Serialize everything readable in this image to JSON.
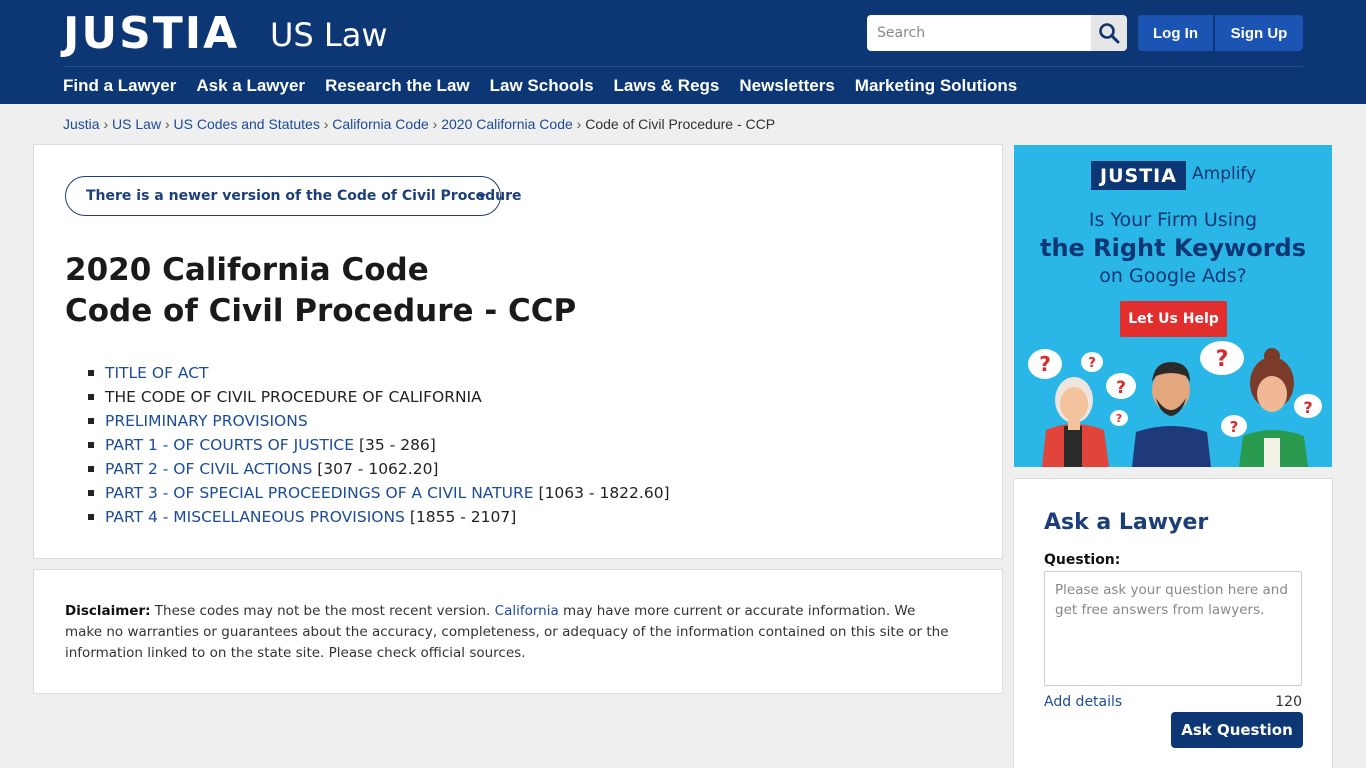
{
  "header": {
    "logo": "JUSTIA",
    "logo_sub": "US Law",
    "search_placeholder": "Search",
    "login_label": "Log In",
    "signup_label": "Sign Up",
    "nav": [
      "Find a Lawyer",
      "Ask a Lawyer",
      "Research the Law",
      "Law Schools",
      "Laws & Regs",
      "Newsletters",
      "Marketing Solutions"
    ]
  },
  "breadcrumb": {
    "items": [
      "Justia",
      "US Law",
      "US Codes and Statutes",
      "California Code",
      "2020 California Code"
    ],
    "current": "Code of Civil Procedure - CCP",
    "separator": "›"
  },
  "main": {
    "version_notice": "There is a newer version of the Code of Civil Procedure",
    "title_line1": "2020 California Code",
    "title_line2": "Code of Civil Procedure - CCP",
    "toc": [
      {
        "label": "TITLE OF ACT",
        "range": "",
        "link": true
      },
      {
        "label": "THE CODE OF CIVIL PROCEDURE OF CALIFORNIA",
        "range": "",
        "link": false
      },
      {
        "label": "PRELIMINARY PROVISIONS",
        "range": "",
        "link": true
      },
      {
        "label": "PART 1 - OF COURTS OF JUSTICE",
        "range": "[35 - 286]",
        "link": true
      },
      {
        "label": "PART 2 - OF CIVIL ACTIONS",
        "range": "[307 - 1062.20]",
        "link": true
      },
      {
        "label": "PART 3 - OF SPECIAL PROCEEDINGS OF A CIVIL NATURE",
        "range": "[1063 - 1822.60]",
        "link": true
      },
      {
        "label": "PART 4 - MISCELLANEOUS PROVISIONS",
        "range": "[1855 - 2107]",
        "link": true
      }
    ]
  },
  "disclaimer": {
    "label": "Disclaimer:",
    "text_before": " These codes may not be the most recent version. ",
    "link": "California",
    "text_after": " may have more current or accurate information. We make no warranties or guarantees about the accuracy, completeness, or adequacy of the information contained on this site or the information linked to on the state site. Please check official sources."
  },
  "ad": {
    "logo": "JUSTIA",
    "product": "Amplify",
    "line1": "Is Your Firm Using",
    "line2": "the Right Keywords",
    "line3": "on Google Ads?",
    "cta": "Let Us Help"
  },
  "ask": {
    "title": "Ask a Lawyer",
    "question_label": "Question:",
    "placeholder": "Please ask your question here and get free answers from lawyers.",
    "add_details": "Add details",
    "char_count": "120",
    "button": "Ask Question"
  },
  "colors": {
    "header_bg": "#0c3674",
    "header_button": "#1b54b3",
    "link": "#1c4b99",
    "ad_bg": "#2ab7e7",
    "ad_cta": "#e32e2e"
  }
}
